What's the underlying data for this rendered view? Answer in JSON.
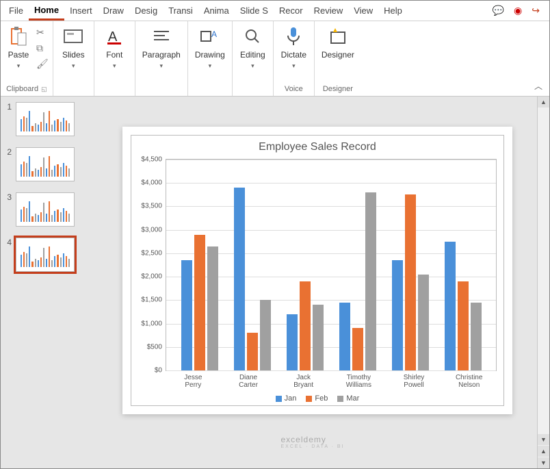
{
  "tabs": {
    "items": [
      "File",
      "Home",
      "Insert",
      "Draw",
      "Desig",
      "Transi",
      "Anima",
      "Slide S",
      "Recor",
      "Review",
      "View",
      "Help"
    ],
    "active": "Home"
  },
  "qat": {
    "comment": "💬",
    "record": "◉",
    "share": "↪"
  },
  "ribbon": {
    "clipboard": {
      "paste": "Paste",
      "label": "Clipboard"
    },
    "slides": {
      "btn": "Slides"
    },
    "font": {
      "btn": "Font"
    },
    "paragraph": {
      "btn": "Paragraph"
    },
    "drawing": {
      "btn": "Drawing"
    },
    "editing": {
      "btn": "Editing"
    },
    "voice": {
      "btn": "Dictate",
      "label": "Voice"
    },
    "designer": {
      "btn": "Designer",
      "label": "Designer"
    }
  },
  "thumbnails": {
    "count": 4,
    "selected": 4
  },
  "chart_data": {
    "type": "bar",
    "title": "Employee Sales Record",
    "ylabel": "",
    "xlabel": "",
    "ylim": [
      0,
      4500
    ],
    "yticks": [
      "$0",
      "$500",
      "$1,000",
      "$1,500",
      "$2,000",
      "$2,500",
      "$3,000",
      "$3,500",
      "$4,000",
      "$4,500"
    ],
    "categories": [
      "Jesse Perry",
      "Diane Carter",
      "Jack Bryant",
      "Timothy Williams",
      "Shirley Powell",
      "Christine Nelson"
    ],
    "series": [
      {
        "name": "Jan",
        "color": "#4a90d9",
        "values": [
          2350,
          3900,
          1200,
          1450,
          2350,
          2750
        ]
      },
      {
        "name": "Feb",
        "color": "#e97132",
        "values": [
          2900,
          800,
          1900,
          900,
          3750,
          1900
        ]
      },
      {
        "name": "Mar",
        "color": "#a0a0a0",
        "values": [
          2650,
          1500,
          1400,
          3800,
          2050,
          1450
        ]
      }
    ]
  },
  "watermark": {
    "brand": "exceldemy",
    "tag": "EXCEL · DATA · BI"
  }
}
